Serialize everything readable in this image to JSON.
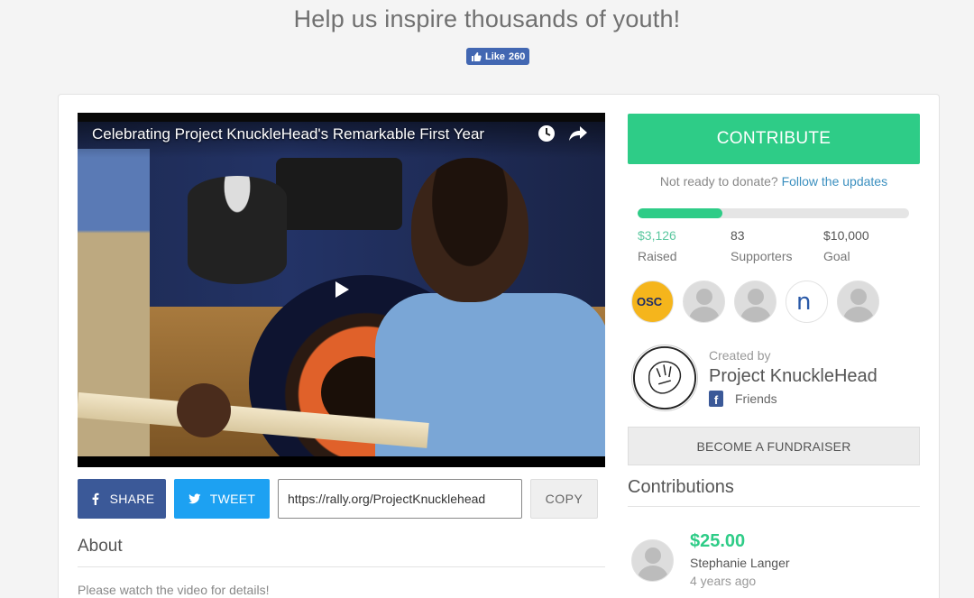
{
  "header": {
    "headline": "Help us inspire thousands of youth!",
    "fb_like_label": "Like",
    "fb_like_count": "260"
  },
  "video": {
    "title": "Celebrating Project KnuckleHead's Remarkable First Year",
    "icons": [
      "clock-icon",
      "share-arrow-icon",
      "play-icon"
    ]
  },
  "share_bar": {
    "share_label": "SHARE",
    "tweet_label": "TWEET",
    "url_value": "https://rally.org/ProjectKnucklehead",
    "copy_label": "COPY"
  },
  "about": {
    "heading": "About",
    "text": "Please watch the video for details!"
  },
  "campaign": {
    "contribute_label": "CONTRIBUTE",
    "not_ready_text": "Not ready to donate?",
    "follow_link": "Follow the updates",
    "progress_fraction": 0.3126,
    "raised_value": "$3,126",
    "raised_label": "Raised",
    "supporters_value": "83",
    "supporters_label": "Supporters",
    "goal_value": "$10,000",
    "goal_label": "Goal",
    "supporter_avatar_texts": [
      "OSC",
      "n"
    ],
    "colors": {
      "accent": "#2ecc87",
      "link": "#3a8fbf",
      "facebook": "#3b5998",
      "twitter": "#1da1f2"
    }
  },
  "creator": {
    "created_by_label": "Created by",
    "name": "Project KnuckleHead",
    "fb_glyph": "f",
    "friends_label": "Friends"
  },
  "fundraiser": {
    "button_label": "BECOME A FUNDRAISER"
  },
  "contributions": {
    "heading": "Contributions",
    "items": [
      {
        "amount": "$25.00",
        "name": "Stephanie Langer",
        "time": "4 years ago"
      }
    ]
  }
}
